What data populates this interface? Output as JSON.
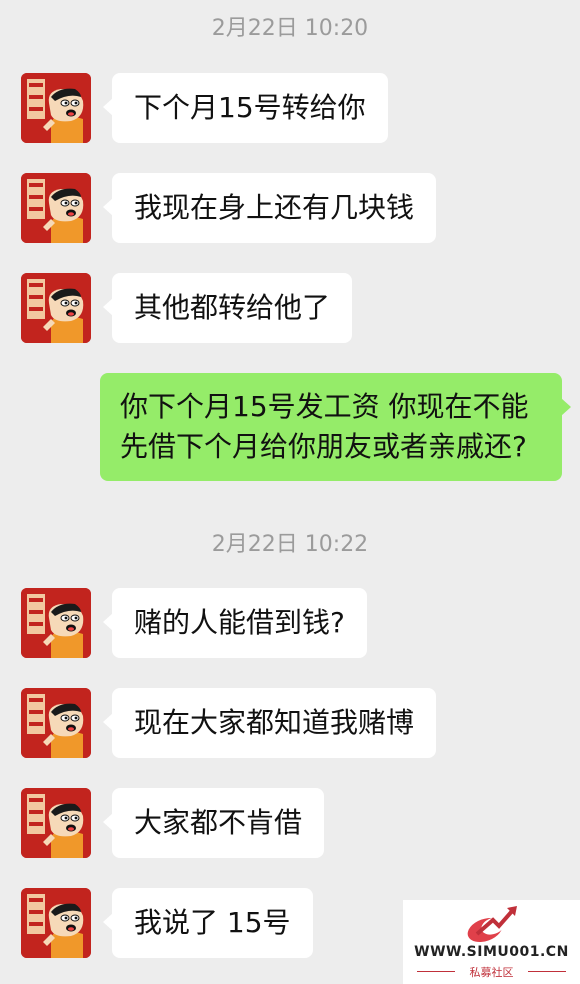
{
  "timestamps": [
    "2月22日 10:20",
    "2月22日 10:22"
  ],
  "messages": [
    {
      "side": "left",
      "text": "下个月15号转给你"
    },
    {
      "side": "left",
      "text": "我现在身上还有几块钱"
    },
    {
      "side": "left",
      "text": "其他都转给他了"
    },
    {
      "side": "right",
      "lines": [
        "你下个月15号发工资 你现在不能",
        "先借下个月给你朋友或者亲戚还?"
      ]
    },
    {
      "side": "left",
      "text": "赌的人能借到钱?"
    },
    {
      "side": "left",
      "text": "现在大家都知道我赌博"
    },
    {
      "side": "left",
      "text": "大家都不肯借"
    },
    {
      "side": "left",
      "text": "我说了 15号"
    }
  ],
  "avatar": {
    "icon": "cartoon-boy-avatar-icon",
    "bg_color": "#c2241e"
  },
  "colors": {
    "background": "#ededed",
    "left_bubble": "#ffffff",
    "right_bubble": "#95ec69"
  },
  "watermark": {
    "url": "WWW.SIMU001.CN",
    "subtitle": "私募社区"
  }
}
